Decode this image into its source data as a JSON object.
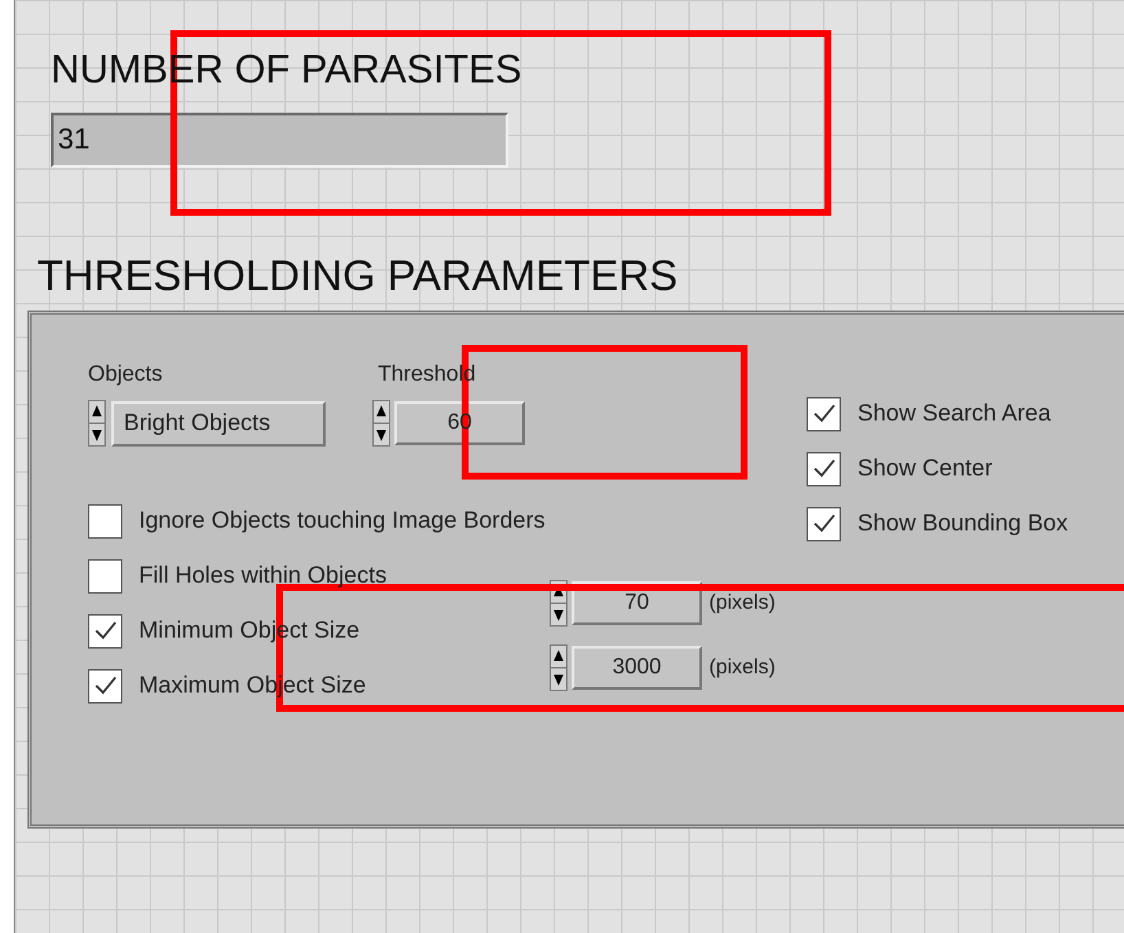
{
  "indicator": {
    "label": "NUMBER OF PARASITES",
    "value": "31"
  },
  "section_title": "THRESHOLDING PARAMETERS",
  "objects": {
    "label": "Objects",
    "value": "Bright Objects"
  },
  "threshold": {
    "label": "Threshold",
    "value": "60"
  },
  "options": [
    {
      "label": "Ignore Objects touching Image Borders",
      "checked": false
    },
    {
      "label": "Fill Holes within Objects",
      "checked": false
    },
    {
      "label": "Minimum Object Size",
      "checked": true,
      "value": "70",
      "unit": "(pixels)"
    },
    {
      "label": "Maximum Object Size",
      "checked": true,
      "value": "3000",
      "unit": "(pixels)"
    }
  ],
  "display_options": [
    {
      "label": "Show Search Area",
      "checked": true
    },
    {
      "label": "Show Center",
      "checked": true
    },
    {
      "label": "Show Bounding Box",
      "checked": true
    }
  ]
}
